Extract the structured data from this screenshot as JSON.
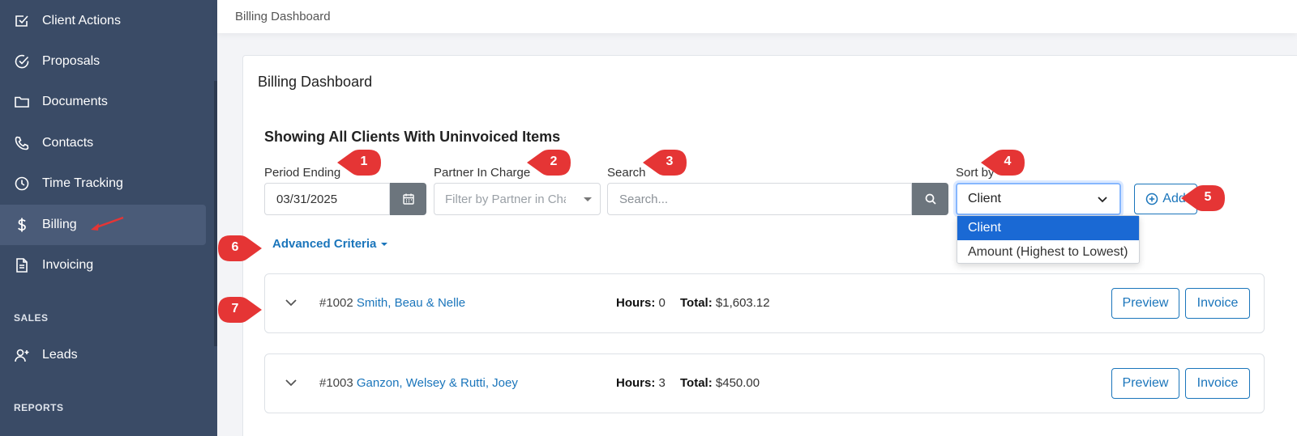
{
  "sidebar": {
    "items": [
      {
        "label": "Client Actions",
        "icon": "checkbox-icon"
      },
      {
        "label": "Proposals",
        "icon": "check-circle-icon"
      },
      {
        "label": "Documents",
        "icon": "folder-icon"
      },
      {
        "label": "Contacts",
        "icon": "phone-icon"
      },
      {
        "label": "Time Tracking",
        "icon": "clock-icon"
      },
      {
        "label": "Billing",
        "icon": "dollar-icon"
      },
      {
        "label": "Invoicing",
        "icon": "document-icon"
      },
      {
        "label": "Leads",
        "icon": "user-plus-icon"
      }
    ],
    "sections": {
      "sales": "SALES",
      "reports": "REPORTS"
    }
  },
  "topbar": {
    "title": "Billing Dashboard"
  },
  "card": {
    "title": "Billing Dashboard",
    "heading": "Showing All Clients With Uninvoiced Items"
  },
  "filters": {
    "period_label": "Period Ending",
    "period_value": "03/31/2025",
    "partner_label": "Partner In Charge",
    "partner_placeholder": "Filter by Partner in Charge",
    "search_label": "Search",
    "search_placeholder": "Search...",
    "sort_label": "Sort by",
    "sort_value": "Client",
    "sort_options": [
      "Client",
      "Amount (Highest to Lowest)"
    ],
    "add_label": "Add",
    "advanced_label": "Advanced Criteria"
  },
  "rows": [
    {
      "number": "#1002",
      "client": "Smith, Beau & Nelle",
      "hours_label": "Hours:",
      "hours": "0",
      "total_label": "Total:",
      "total": "$1,603.12",
      "preview": "Preview",
      "invoice": "Invoice"
    },
    {
      "number": "#1003",
      "client": "Ganzon, Welsey & Rutti, Joey",
      "hours_label": "Hours:",
      "hours": "3",
      "total_label": "Total:",
      "total": "$450.00",
      "preview": "Preview",
      "invoice": "Invoice"
    }
  ],
  "markers": [
    "1",
    "2",
    "3",
    "4",
    "5",
    "6",
    "7"
  ],
  "colors": {
    "sidebar": "#3a4b66",
    "accent": "#1a75bb",
    "marker": "#e53535",
    "selected_option": "#1a69d4"
  }
}
